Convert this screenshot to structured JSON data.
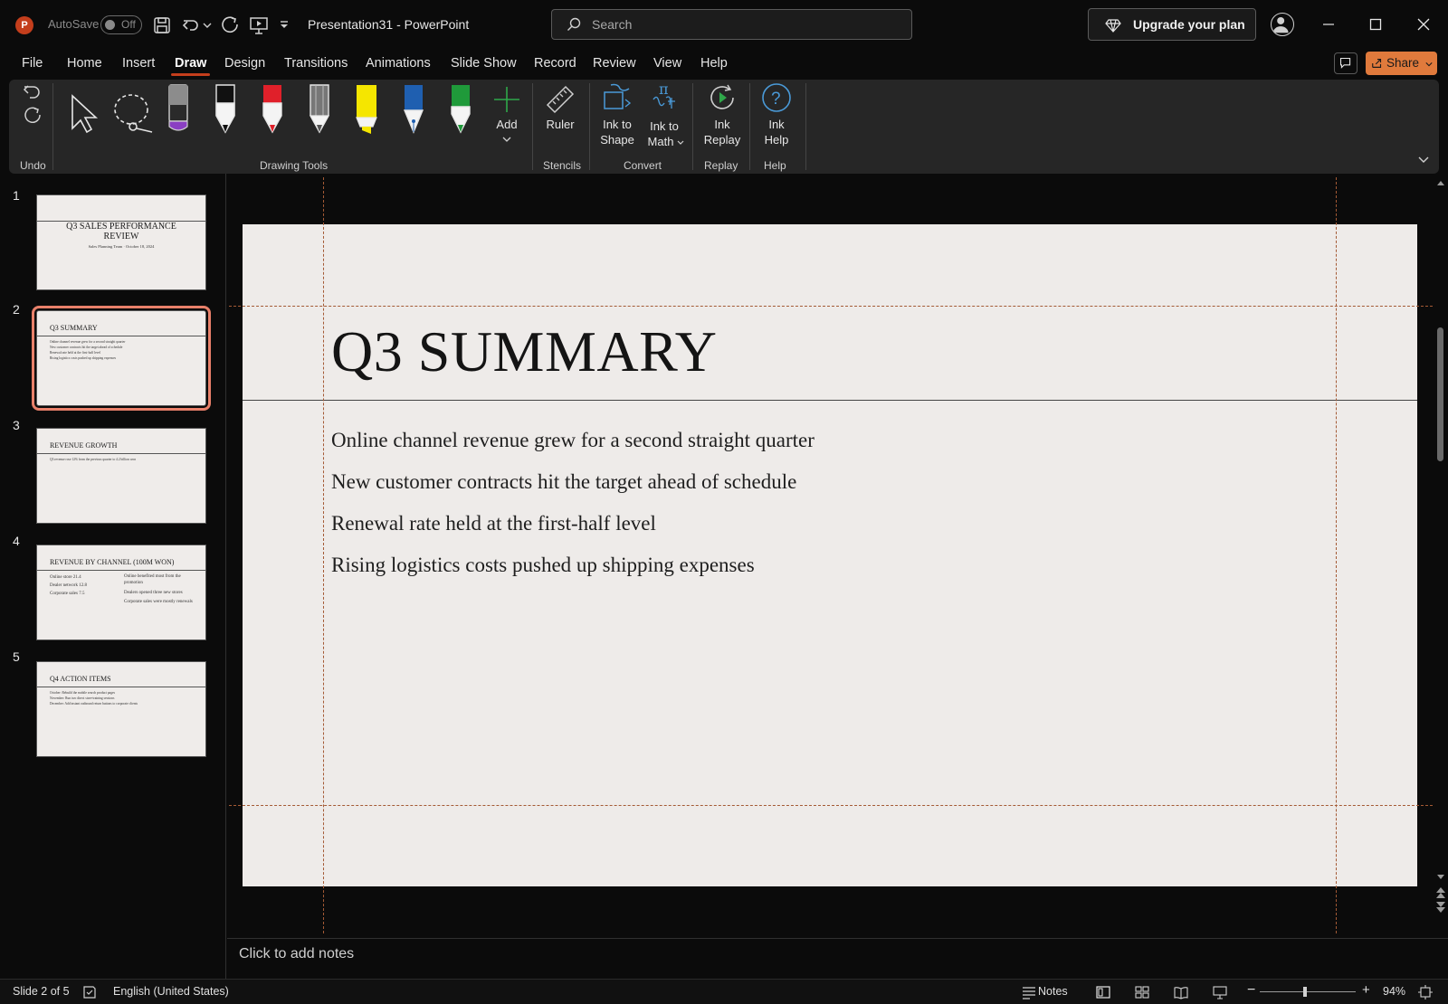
{
  "titlebar": {
    "app_icon_letter": "P",
    "autosave_label": "AutoSave",
    "autosave_state": "Off",
    "document_title": "Presentation31  -  PowerPoint",
    "search_placeholder": "Search",
    "upgrade_label": "Upgrade your plan"
  },
  "menu": {
    "tabs": [
      "File",
      "Home",
      "Insert",
      "Draw",
      "Design",
      "Transitions",
      "Animations",
      "Slide Show",
      "Record",
      "Review",
      "View",
      "Help"
    ],
    "active_tab": "Draw",
    "share_label": "Share"
  },
  "ribbon": {
    "groups": {
      "undo": "Undo",
      "drawing_tools": "Drawing Tools",
      "stencils": "Stencils",
      "convert": "Convert",
      "replay": "Replay",
      "help": "Help"
    },
    "add_label": "Add",
    "ruler_label": "Ruler",
    "ink_to_shape_1": "Ink to",
    "ink_to_shape_2": "Shape",
    "ink_to_math_1": "Ink to",
    "ink_to_math_2": "Math",
    "ink_replay_1": "Ink",
    "ink_replay_2": "Replay",
    "ink_help_1": "Ink",
    "ink_help_2": "Help",
    "pen_colors": [
      "#7a3fb2",
      "#111111",
      "#e0202a",
      "#8a8a8a",
      "#f5e600",
      "#1f5fb0",
      "#1f9a3a"
    ]
  },
  "thumbnails": [
    {
      "number": "1",
      "title": "Q3 SALES PERFORMANCE REVIEW",
      "subtitle": "Sales Planning Team · October 18, 2024"
    },
    {
      "number": "2",
      "title": "Q3 SUMMARY",
      "lines": [
        "Online channel revenue grew for a second straight quarter",
        "New customer contracts hit the target ahead of schedule",
        "Renewal rate held at the first-half level",
        "Rising logistics costs pushed up shipping expenses"
      ]
    },
    {
      "number": "3",
      "title": "REVENUE GROWTH",
      "lines": [
        "Q3 revenue rose 12% from the previous quarter to 4.2 billion won"
      ]
    },
    {
      "number": "4",
      "title": "REVENUE BY CHANNEL (100M WON)",
      "left": [
        "Online store 21.4",
        "Dealer network 12.8",
        "Corporate sales 7.5"
      ],
      "right": [
        "Online benefited most from the promotion",
        "Dealers opened three new stores",
        "Corporate sales were mostly renewals"
      ]
    },
    {
      "number": "5",
      "title": "Q4 ACTION ITEMS",
      "lines": [
        "October: Rebuild the mobile search product pages",
        "November: Run two direct store-training sessions",
        "December: Add instant outbound return buttons to corporate clients"
      ]
    }
  ],
  "slide": {
    "title": "Q3 SUMMARY",
    "bullets": [
      "Online channel revenue grew for a second straight quarter",
      "New customer contracts hit the target ahead of schedule",
      "Renewal rate held at the first-half level",
      "Rising logistics costs pushed up shipping expenses"
    ]
  },
  "notes_placeholder": "Click to add notes",
  "status": {
    "slide_indicator": "Slide 2 of 5",
    "language": "English (United States)",
    "notes_label": "Notes",
    "zoom": "94%",
    "zoom_fraction": 0.47
  },
  "colors": {
    "accent": "#c43e1c",
    "share": "#e07a3c",
    "selection": "#e8806a"
  }
}
